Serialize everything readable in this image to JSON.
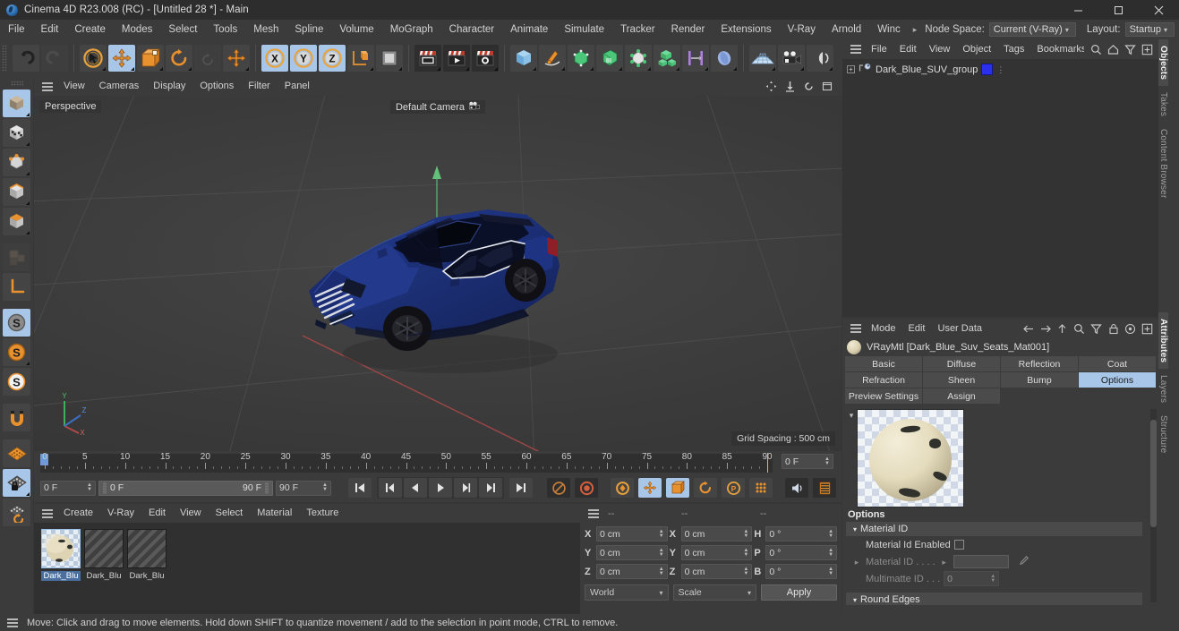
{
  "window": {
    "title": "Cinema 4D R23.008 (RC) - [Untitled 28 *] - Main",
    "minimize_label": "–",
    "maximize_label": "□",
    "close_label": "✕"
  },
  "menubar": {
    "items": [
      "File",
      "Edit",
      "Create",
      "Modes",
      "Select",
      "Tools",
      "Mesh",
      "Spline",
      "Volume",
      "MoGraph",
      "Character",
      "Animate",
      "Simulate",
      "Tracker",
      "Render",
      "Extensions",
      "V-Ray",
      "Arnold",
      "Winc"
    ],
    "overflow_arrow": "▸",
    "node_space_label": "Node Space:",
    "node_space_value": "Current (V-Ray)",
    "layout_label": "Layout:",
    "layout_value": "Startup",
    "search_icon": "search-icon"
  },
  "toolbar": {
    "groups": [
      {
        "name": "history",
        "buttons": [
          {
            "name": "undo-button",
            "icon": "undo-icon",
            "state": "normal"
          },
          {
            "name": "redo-button",
            "icon": "redo-icon",
            "state": "disabled"
          }
        ]
      },
      {
        "name": "tools",
        "buttons": [
          {
            "name": "live-selection-tool",
            "icon": "cursor-circle-icon",
            "state": "normal"
          },
          {
            "name": "move-tool",
            "icon": "move-arrows-icon",
            "state": "active"
          },
          {
            "name": "scale-tool",
            "icon": "scale-box-icon",
            "state": "normal"
          },
          {
            "name": "rotate-tool",
            "icon": "rotate-ring-icon",
            "state": "normal"
          },
          {
            "name": "rotate-tool-alt",
            "icon": "rotate-small-icon",
            "state": "disabled"
          },
          {
            "name": "move-axis-tool",
            "icon": "move-cross-icon",
            "state": "normal"
          }
        ]
      },
      {
        "name": "axis-locks",
        "buttons": [
          {
            "name": "x-axis-lock",
            "icon": "x-axis-icon",
            "state": "active"
          },
          {
            "name": "y-axis-lock",
            "icon": "y-axis-icon",
            "state": "active"
          },
          {
            "name": "z-axis-lock",
            "icon": "z-axis-icon",
            "state": "active"
          },
          {
            "name": "world-coordinate-system",
            "icon": "world-axis-icon",
            "state": "normal"
          },
          {
            "name": "render-region",
            "icon": "render-region-icon",
            "state": "normal"
          }
        ]
      },
      {
        "name": "render",
        "buttons": [
          {
            "name": "render-view-button",
            "icon": "render-view-icon",
            "state": "dark"
          },
          {
            "name": "render-to-picture-viewer-button",
            "icon": "render-picture-icon",
            "state": "dark"
          },
          {
            "name": "render-settings-button",
            "icon": "render-settings-icon",
            "state": "dark"
          }
        ]
      },
      {
        "name": "objects",
        "buttons": [
          {
            "name": "add-cube-button",
            "icon": "cube-icon",
            "state": "normal"
          },
          {
            "name": "add-spline-button",
            "icon": "pen-spline-icon",
            "state": "normal"
          },
          {
            "name": "generator-button",
            "icon": "generator-icon",
            "state": "normal"
          },
          {
            "name": "spline-generator-button",
            "icon": "spline-gen-icon",
            "state": "normal"
          },
          {
            "name": "deformer-button",
            "icon": "deformer-icon",
            "state": "normal"
          },
          {
            "name": "array-button",
            "icon": "array-cubes-icon",
            "state": "normal"
          },
          {
            "name": "scene-button",
            "icon": "scene-icon",
            "state": "normal"
          },
          {
            "name": "field-button",
            "icon": "field-icon",
            "state": "normal"
          }
        ]
      },
      {
        "name": "scene",
        "buttons": [
          {
            "name": "add-floor-button",
            "icon": "floor-grid-icon",
            "state": "normal"
          },
          {
            "name": "add-camera-button",
            "icon": "camera-icon",
            "state": "normal"
          },
          {
            "name": "add-light-button",
            "icon": "light-icon",
            "state": "normal"
          }
        ]
      }
    ]
  },
  "left_toolbar": {
    "buttons": [
      {
        "name": "model-mode",
        "icon": "model-cube-icon",
        "state": "active"
      },
      {
        "name": "texture-mode",
        "icon": "texture-cube-icon",
        "state": "normal"
      },
      {
        "name": "points-mode",
        "icon": "points-cube-icon",
        "state": "normal"
      },
      {
        "name": "edges-mode",
        "icon": "edges-cube-icon",
        "state": "normal"
      },
      {
        "name": "polygons-mode",
        "icon": "polygons-cube-icon",
        "state": "normal"
      },
      {
        "name": "uv-mode",
        "icon": "uv-icon",
        "state": "disabled"
      },
      {
        "name": "axis-modify-mode",
        "icon": "axis-l-icon",
        "state": "normal"
      },
      {
        "name": "enable-axis-mode",
        "icon": "s-gray-icon",
        "state": "active"
      },
      {
        "name": "object-axis-mode",
        "icon": "s-orange-icon",
        "state": "normal"
      },
      {
        "name": "world-axis-mode",
        "icon": "s-white-icon",
        "state": "normal"
      },
      {
        "name": "magnet-tool",
        "icon": "magnet-icon",
        "state": "normal"
      },
      {
        "name": "workplane-mode",
        "icon": "workplane-icon",
        "state": "normal"
      },
      {
        "name": "lock-workplane",
        "icon": "workplane-lock-icon",
        "state": "active"
      },
      {
        "name": "planar-workplane",
        "icon": "workplane-rotate-icon",
        "state": "normal"
      }
    ]
  },
  "viewport": {
    "menu": [
      "View",
      "Cameras",
      "Display",
      "Options",
      "Filter",
      "Panel"
    ],
    "view_label": "Perspective",
    "camera_label": "Default Camera",
    "camera_icon": "camera-icon",
    "grid_spacing": "Grid Spacing : 500 cm",
    "axis_gizmo": {
      "x": "X",
      "y": "Y",
      "z": "Z"
    },
    "corner_icons": [
      "pan-icon",
      "dolly-icon",
      "rotate-icon",
      "maximize-icon"
    ],
    "object_name": "Dark Blue SUV",
    "object_body_color": "#1b2a6b"
  },
  "timeline": {
    "ticks": [
      0,
      5,
      10,
      15,
      20,
      25,
      30,
      35,
      40,
      45,
      50,
      55,
      60,
      65,
      70,
      75,
      80,
      85,
      90
    ],
    "range_start": "0 F",
    "range_end": "90 F",
    "current_frame": "0 F",
    "preview_start": "0 F",
    "preview_end": "90 F",
    "frame_field_right": "0 F",
    "transport": [
      {
        "name": "go-to-start-button",
        "icon": "skip-start-icon"
      },
      {
        "name": "previous-key-button",
        "icon": "prev-key-icon"
      },
      {
        "name": "step-back-button",
        "icon": "step-back-icon"
      },
      {
        "name": "play-button",
        "icon": "play-icon"
      },
      {
        "name": "step-forward-button",
        "icon": "step-forward-icon"
      },
      {
        "name": "next-key-button",
        "icon": "next-key-icon"
      },
      {
        "name": "go-to-end-button",
        "icon": "skip-end-icon"
      }
    ],
    "record_tools": [
      {
        "name": "autokey-button",
        "icon": "autokey-icon"
      },
      {
        "name": "record-button",
        "icon": "record-icon"
      },
      {
        "name": "keyframe-selection-button",
        "icon": "key-select-icon"
      },
      {
        "name": "record-position-button",
        "icon": "record-position-icon"
      },
      {
        "name": "record-scale-button",
        "icon": "record-scale-icon"
      },
      {
        "name": "record-rotation-button",
        "icon": "record-rotation-icon"
      },
      {
        "name": "record-pla-button",
        "icon": "record-pla-icon"
      },
      {
        "name": "record-param-button",
        "icon": "record-param-icon"
      },
      {
        "name": "sound-button",
        "icon": "sound-icon"
      },
      {
        "name": "timeline-button",
        "icon": "timeline-icon"
      }
    ]
  },
  "material_manager": {
    "menu": [
      "Create",
      "V-Ray",
      "Edit",
      "View",
      "Select",
      "Material",
      "Texture"
    ],
    "materials": [
      {
        "name": "Dark_Blu",
        "type": "preview",
        "selected": true
      },
      {
        "name": "Dark_Blu",
        "type": "stripes",
        "selected": false
      },
      {
        "name": "Dark_Blu",
        "type": "stripes",
        "selected": false
      }
    ]
  },
  "coordinates": {
    "header": [
      "--",
      "--",
      "--"
    ],
    "rows": [
      {
        "pos_label": "X",
        "pos_value": "0 cm",
        "size_label": "X",
        "size_value": "0 cm",
        "rot_label": "H",
        "rot_value": "0 °"
      },
      {
        "pos_label": "Y",
        "pos_value": "0 cm",
        "size_label": "Y",
        "size_value": "0 cm",
        "rot_label": "P",
        "rot_value": "0 °"
      },
      {
        "pos_label": "Z",
        "pos_value": "0 cm",
        "size_label": "Z",
        "size_value": "0 cm",
        "rot_label": "B",
        "rot_value": "0 °"
      }
    ],
    "system_value": "World",
    "mode_value": "Scale",
    "apply_label": "Apply"
  },
  "object_manager": {
    "menu": [
      "File",
      "Edit",
      "View",
      "Object",
      "Tags",
      "Bookmarks"
    ],
    "icons": [
      "search-icon",
      "home-icon",
      "filter-icon",
      "add-icon"
    ],
    "objects": [
      {
        "name": "Dark_Blue_SUV_group",
        "icon": "null-object-icon",
        "tag_color": "#2b30ef"
      }
    ]
  },
  "attribute_manager": {
    "menu": [
      "Mode",
      "Edit",
      "User Data"
    ],
    "icons": [
      "back-arrow-icon",
      "forward-arrow-icon",
      "up-arrow-icon",
      "search-icon",
      "filter-icon",
      "lock-icon",
      "target-icon",
      "add-icon"
    ],
    "title": "VRayMtl [Dark_Blue_Suv_Seats_Mat001]",
    "tabs": [
      {
        "label": "Basic",
        "selected": false
      },
      {
        "label": "Diffuse",
        "selected": false
      },
      {
        "label": "Reflection",
        "selected": false
      },
      {
        "label": "Coat",
        "selected": false
      },
      {
        "label": "Refraction",
        "selected": false
      },
      {
        "label": "Sheen",
        "selected": false
      },
      {
        "label": "Bump",
        "selected": false
      },
      {
        "label": "Options",
        "selected": true
      },
      {
        "label": "Preview Settings",
        "selected": false
      },
      {
        "label": "Assign",
        "selected": false
      }
    ],
    "section_title": "Options",
    "groups": [
      {
        "label": "Material ID",
        "expanded": true
      },
      {
        "label": "Round Edges",
        "expanded": true
      }
    ],
    "properties": [
      {
        "label": "Material Id Enabled",
        "type": "checkbox",
        "value": "",
        "checked": false,
        "dim": false
      },
      {
        "label": "Material ID . . . .",
        "type": "color",
        "value": "",
        "dim": true
      },
      {
        "label": "Multimatte ID . . .",
        "type": "number",
        "value": "0",
        "dim": true
      }
    ]
  },
  "right_tabs": [
    {
      "label": "Objects",
      "selected": true
    },
    {
      "label": "Takes",
      "selected": false
    },
    {
      "label": "Content Browser",
      "selected": false
    },
    {
      "label": "Attributes",
      "selected": true
    },
    {
      "label": "Layers",
      "selected": false
    },
    {
      "label": "Structure",
      "selected": false
    }
  ],
  "statusbar": {
    "text": "Move: Click and drag to move elements. Hold down SHIFT to quantize movement / add to the selection in point mode, CTRL to remove."
  }
}
